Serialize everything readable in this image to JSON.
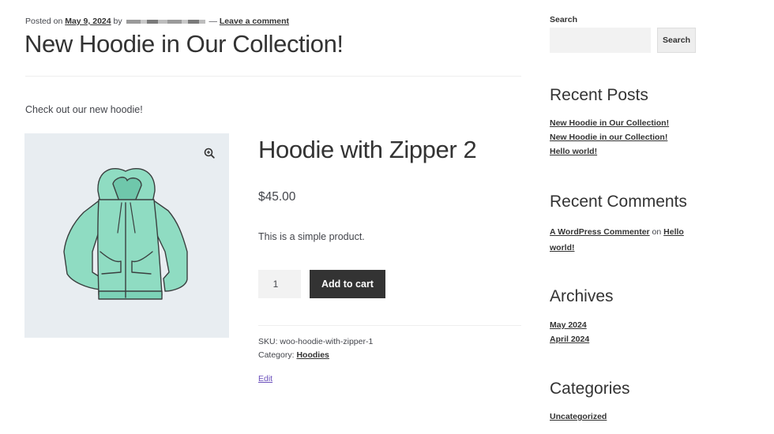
{
  "post": {
    "posted_on": "Posted on",
    "date": "May 9, 2024",
    "by": "by",
    "separator": "—",
    "leave_comment": "Leave a comment",
    "title": "New Hoodie in Our Collection!",
    "intro": "Check out our new hoodie!"
  },
  "product": {
    "title": "Hoodie with Zipper 2",
    "price": "$45.00",
    "description": "This is a simple product.",
    "quantity": "1",
    "add_to_cart": "Add to cart",
    "sku": "SKU: woo-hoodie-with-zipper-1",
    "category_label": "Category:",
    "category": "Hoodies",
    "edit": "Edit",
    "image_icon": "zoom-in-icon"
  },
  "sidebar": {
    "search_label": "Search",
    "search_button": "Search",
    "recent_posts_title": "Recent Posts",
    "recent_posts": [
      "New Hoodie in Our Collection!",
      "New Hoodie in our Collection!",
      "Hello world!"
    ],
    "recent_comments_title": "Recent Comments",
    "comment_author": "A WordPress Commenter",
    "comment_on": "on",
    "comment_post": "Hello world!",
    "archives_title": "Archives",
    "archives": [
      "May 2024",
      "April 2024"
    ],
    "categories_title": "Categories",
    "categories": [
      "Uncategorized"
    ]
  },
  "colors": {
    "hoodie": "#8fdcc2",
    "button_dark": "#333333",
    "link": "#333333",
    "edit_link": "#6b4fbb",
    "image_bg": "#e8edf1"
  }
}
